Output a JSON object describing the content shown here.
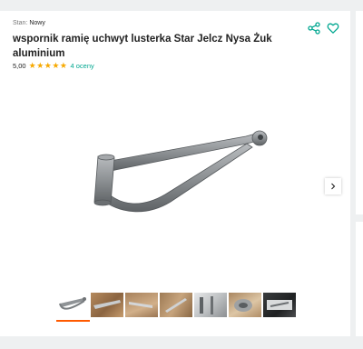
{
  "product": {
    "condition_label": "Stan:",
    "condition_value": "Nowy",
    "title": "wspornik ramię uchwyt lusterka Star Jelcz Nysa Żuk aluminium",
    "rating_value": "5,00",
    "rating_stars": 5,
    "reviews_label": "4 oceny"
  },
  "gallery": {
    "main_image": "aluminium mirror bracket arm",
    "thumbnails": [
      "bracket-arm-photo",
      "bracket-on-wood-photo",
      "bracket-on-wood-photo",
      "bracket-on-wood-photo",
      "bracket-on-paper-photo",
      "bracket-closeup-photo",
      "bracket-dark-photo"
    ],
    "selected_thumbnail": 1
  },
  "icons": {
    "share": "share-icon",
    "favorite": "heart-icon",
    "next": "chevron-right-icon"
  },
  "colors": {
    "accent": "#00a790",
    "star": "#f7a900",
    "active_underline": "#ff5a00",
    "title": "#222222"
  }
}
